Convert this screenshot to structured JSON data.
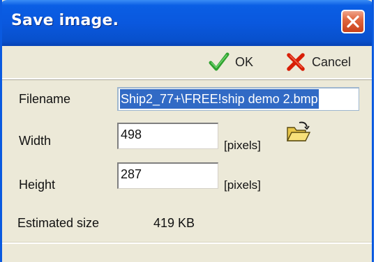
{
  "window": {
    "title": "Save image."
  },
  "toolbar": {
    "ok_label": "OK",
    "cancel_label": "Cancel"
  },
  "form": {
    "filename": {
      "label": "Filename",
      "value": "Ship2_77+\\FREE!ship demo 2.bmp"
    },
    "width": {
      "label": "Width",
      "value": "498",
      "unit": "[pixels]"
    },
    "height": {
      "label": "Height",
      "value": "287",
      "unit": "[pixels]"
    }
  },
  "estimate": {
    "label": "Estimated size",
    "value": "419 KB"
  },
  "icons": {
    "close": "close-icon",
    "ok": "checkmark-icon",
    "cancel": "x-icon",
    "browse": "open-folder-icon"
  },
  "colors": {
    "titlebar": "#0a58de",
    "dialog_bg": "#ece9d8",
    "close_button": "#e0673f",
    "ok_green": "#2ea12e",
    "cancel_red": "#d81e06",
    "selection": "#316ac5"
  }
}
